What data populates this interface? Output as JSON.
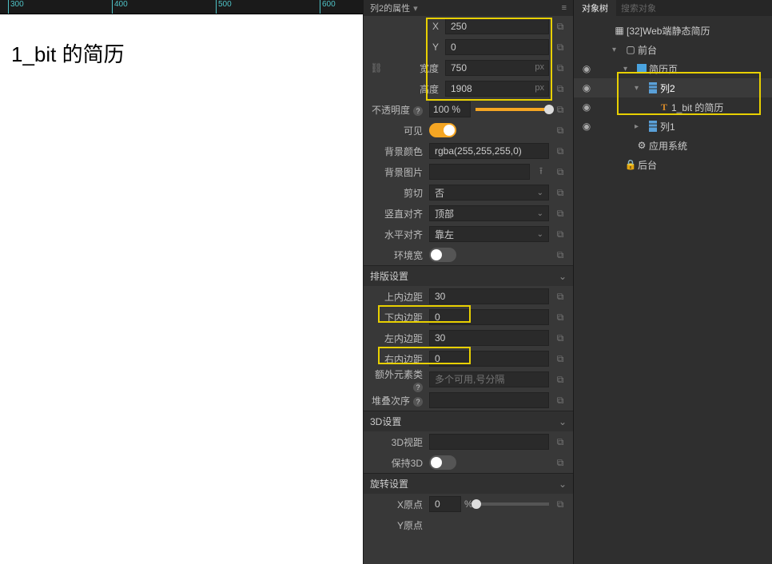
{
  "canvas": {
    "ruler_ticks": [
      "300",
      "400",
      "500",
      "600"
    ],
    "title_text": "1_bit 的简历"
  },
  "props_header": {
    "title": "列2的属性",
    "chev": "▾"
  },
  "props": {
    "x_label": "X",
    "x_value": "250",
    "y_label": "Y",
    "y_value": "0",
    "w_label": "宽度",
    "w_value": "750",
    "w_unit": "px",
    "h_label": "高度",
    "h_value": "1908",
    "h_unit": "px",
    "opacity_label": "不透明度",
    "opacity_value": "100 %",
    "visible_label": "可见",
    "bgcolor_label": "背景颜色",
    "bgcolor_value": "rgba(255,255,255,0)",
    "bgimg_label": "背景图片",
    "bgimg_value": "",
    "clip_label": "剪切",
    "clip_value": "否",
    "valign_label": "竖直对齐",
    "valign_value": "顶部",
    "halign_label": "水平对齐",
    "halign_value": "靠左",
    "envw_label": "环境宽"
  },
  "layout_section": {
    "title": "排版设置",
    "pad_top_label": "上内边距",
    "pad_top_value": "30",
    "pad_bottom_label": "下内边距",
    "pad_bottom_value": "0",
    "pad_left_label": "左内边距",
    "pad_left_value": "30",
    "pad_right_label": "右内边距",
    "pad_right_value": "0",
    "extra_class_label": "额外元素类",
    "extra_class_placeholder": "多个可用,号分隔",
    "zindex_label": "堆叠次序",
    "zindex_value": ""
  },
  "three_d": {
    "title": "3D设置",
    "perspective_label": "3D视距",
    "perspective_value": "",
    "preserve3d_label": "保持3D"
  },
  "rotate": {
    "title": "旋转设置",
    "xorigin_label": "X原点",
    "xorigin_value": "0",
    "xorigin_unit": "%",
    "yorigin_label": "Y原点"
  },
  "tree": {
    "tab_active": "对象树",
    "search_placeholder": "搜索对象",
    "root": "[32]Web端静态简历",
    "front": "前台",
    "resume_page": "简历页",
    "col2": "列2",
    "text_item": "1_bit 的简历",
    "col1": "列1",
    "app_system": "应用系统",
    "back": "后台"
  }
}
